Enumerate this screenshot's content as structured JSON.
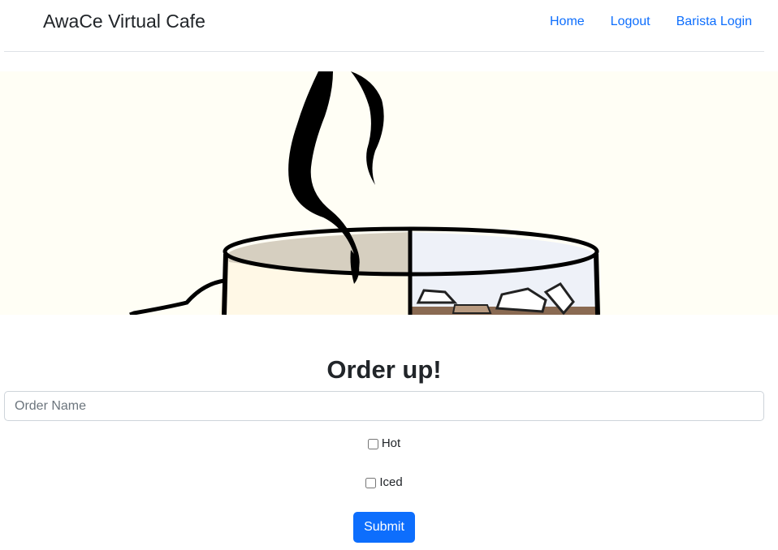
{
  "navbar": {
    "brand": "AwaCe Virtual Cafe",
    "links": [
      {
        "label": "Home"
      },
      {
        "label": "Logout"
      },
      {
        "label": "Barista Login"
      }
    ]
  },
  "hero": {
    "image_subject": "coffee-cup-hot-and-iced-icon"
  },
  "order_form": {
    "heading": "Order up!",
    "name_placeholder": "Order Name",
    "name_value": "",
    "options": [
      {
        "label": "Hot",
        "checked": false
      },
      {
        "label": "Iced",
        "checked": false
      }
    ],
    "submit_label": "Submit"
  },
  "colors": {
    "link": "#0d6efd",
    "button": "#0d6efd",
    "hero_background": "#fffef5"
  }
}
